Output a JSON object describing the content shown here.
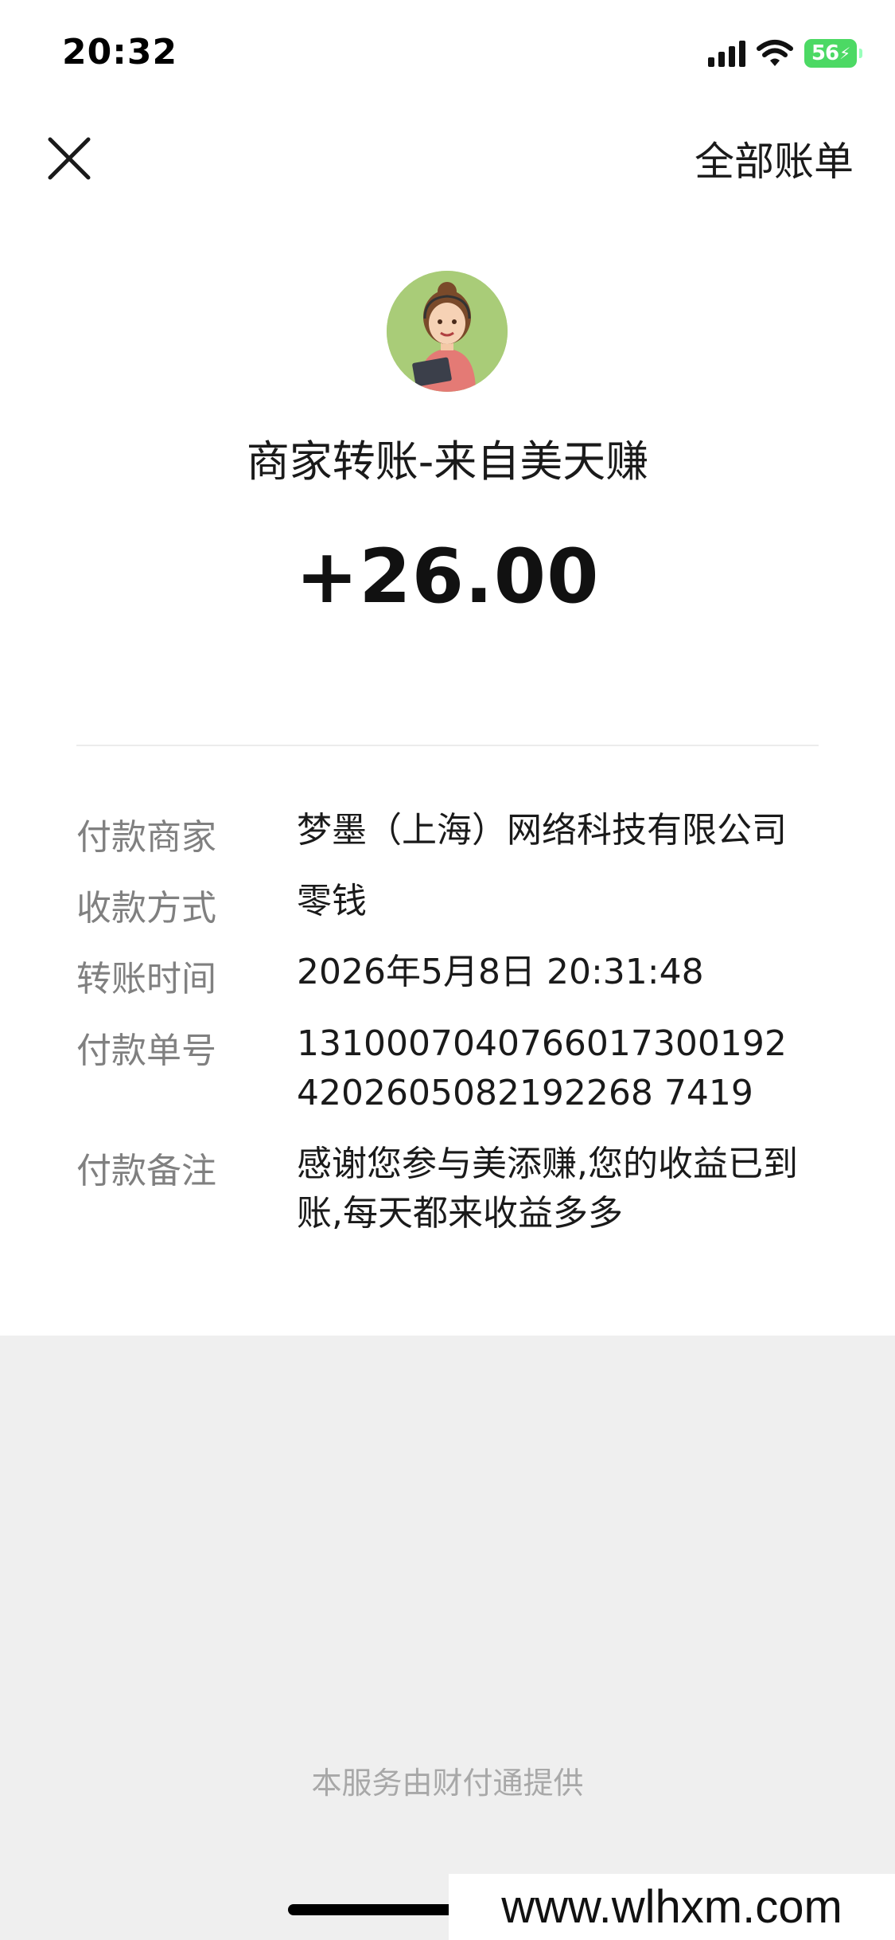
{
  "status_bar": {
    "time": "20:32",
    "battery_level": "56",
    "icons": [
      "cellular-signal-icon",
      "wifi-icon",
      "battery-charging-icon"
    ]
  },
  "header": {
    "close_icon": "close-icon",
    "all_bills_label": "全部账单"
  },
  "transaction": {
    "title": "商家转账-来自美天赚",
    "amount": "+26.00"
  },
  "details": [
    {
      "label": "付款商家",
      "value": "梦墨（上海）网络科技有限公司"
    },
    {
      "label": "收款方式",
      "value": "零钱"
    },
    {
      "label": "转账时间",
      "value": "2026年5月8日 20:31:48"
    },
    {
      "label": "付款单号",
      "value": "13100070407660173001924202605082192268 7419"
    },
    {
      "label": "付款备注",
      "value": "感谢您参与美添赚,您的收益已到账,每天都来收益多多"
    }
  ],
  "footer": {
    "provider_text": "本服务由财付通提供"
  },
  "watermark": {
    "text": "www.wlhxm.com"
  },
  "colors": {
    "label_gray": "#808080",
    "background_gray": "#efefef",
    "battery_green": "#4cd964"
  }
}
